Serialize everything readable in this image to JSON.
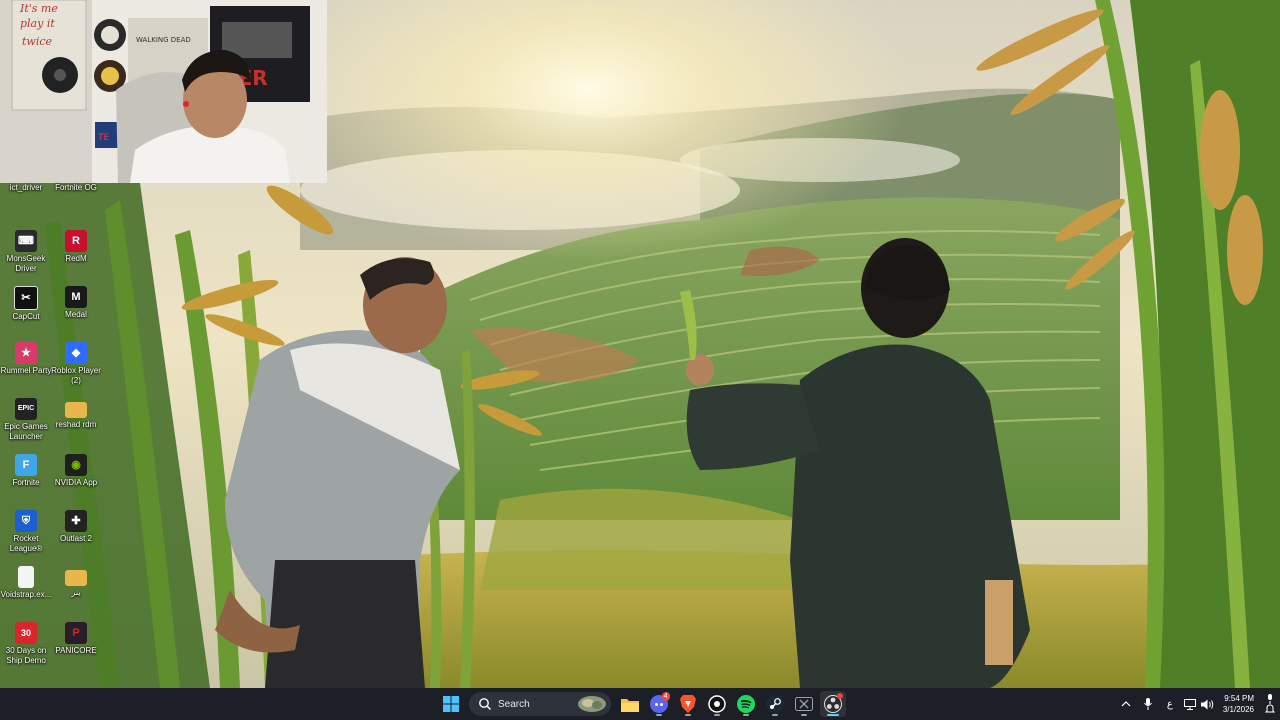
{
  "desktop": {
    "icons": [
      {
        "label": "ict_driver",
        "icon": "driver-icon",
        "color": "#9aa4b8"
      },
      {
        "label": "Fortnite OG",
        "icon": "fortnite-og-icon",
        "color": "#5a6a8a"
      },
      {
        "label": "MonsGeek Driver",
        "icon": "monsgeek-icon",
        "color": "#2b2b2b"
      },
      {
        "label": "RedM",
        "icon": "redm-icon",
        "color": "#c8102e"
      },
      {
        "label": "CapCut",
        "icon": "capcut-icon",
        "color": "#111111"
      },
      {
        "label": "Medal",
        "icon": "medal-icon",
        "color": "#1a1a1a"
      },
      {
        "label": "Rummel Party",
        "icon": "rummel-party-icon",
        "color": "#d83a6a"
      },
      {
        "label": "Roblox Player (2)",
        "icon": "roblox-icon",
        "color": "#2f6bff"
      },
      {
        "label": "Epic Games Launcher",
        "icon": "epic-games-icon",
        "color": "#222222"
      },
      {
        "label": "reshad rdm",
        "icon": "folder-icon",
        "color": "#e8b64a"
      },
      {
        "label": "Fortnite",
        "icon": "fortnite-icon",
        "color": "#3fa7e8"
      },
      {
        "label": "NVIDIA App",
        "icon": "nvidia-icon",
        "color": "#1f1f1f"
      },
      {
        "label": "Rocket League®",
        "icon": "rocket-league-icon",
        "color": "#1d5fd1"
      },
      {
        "label": "Outlast 2",
        "icon": "outlast-icon",
        "color": "#222222"
      },
      {
        "label": "Voidstrap.ex...",
        "icon": "file-icon",
        "color": "#f4f4f4"
      },
      {
        "label": "بنر",
        "icon": "folder-icon",
        "color": "#e8b64a"
      },
      {
        "label": "30 Days on Ship Demo",
        "icon": "30-days-icon",
        "color": "#d8262c"
      },
      {
        "label": "PANICORE",
        "icon": "panicore-icon",
        "color": "#2a1d2a"
      }
    ]
  },
  "taskbar": {
    "search_placeholder": "Search",
    "apps": [
      {
        "name": "start",
        "icon": "windows-icon"
      },
      {
        "name": "search",
        "icon": "search-icon"
      },
      {
        "name": "file-explorer",
        "icon": "folder-icon"
      },
      {
        "name": "discord",
        "icon": "discord-icon",
        "badge": "4"
      },
      {
        "name": "brave",
        "icon": "brave-icon"
      },
      {
        "name": "app-circle",
        "icon": "circle-app-icon"
      },
      {
        "name": "spotify",
        "icon": "spotify-icon"
      },
      {
        "name": "steam",
        "icon": "steam-icon"
      },
      {
        "name": "xbox",
        "icon": "xbox-icon"
      },
      {
        "name": "obs",
        "icon": "obs-icon"
      }
    ],
    "tray": {
      "language": "ع",
      "time": "9:54 PM",
      "date": "3/1/2026"
    }
  },
  "colors": {
    "taskbar_bg": "#1c1f26",
    "accent": "#3fa7e8"
  }
}
